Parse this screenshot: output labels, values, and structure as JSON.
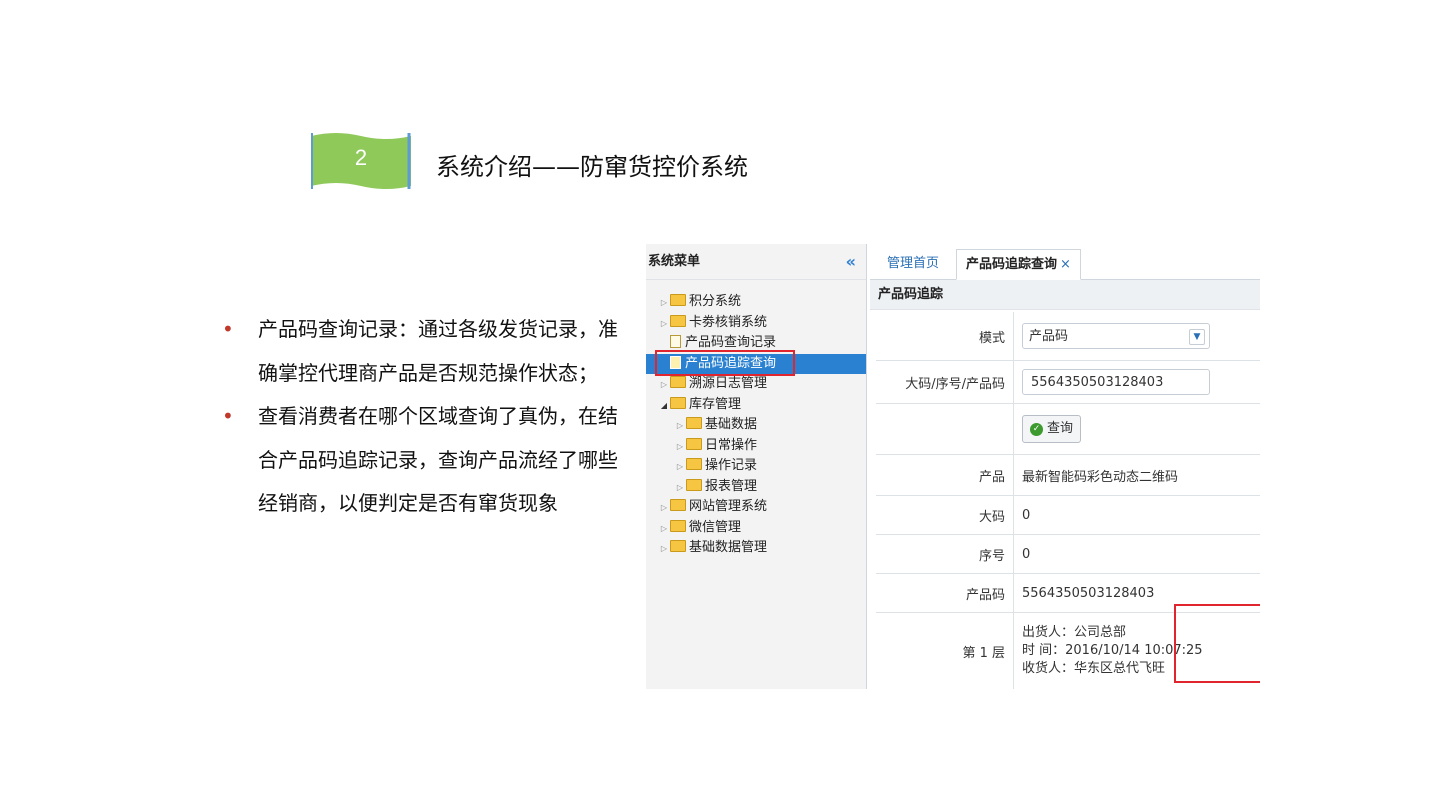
{
  "slide": {
    "section_number": "2",
    "title": "系统介绍——防窜货控价系统",
    "accent_color": "#8fc95a",
    "bullets": [
      "产品码查询记录：通过各级发货记录，准确掌控代理商产品是否规范操作状态；",
      "查看消费者在哪个区域查询了真伪，在结合产品码追踪记录，查询产品流经了哪些经销商，以便判定是否有窜货现象"
    ]
  },
  "sidebar": {
    "title": "系统菜单",
    "items": [
      {
        "label": "积分系统",
        "type": "folder",
        "level": 0
      },
      {
        "label": "卡劵核销系统",
        "type": "folder",
        "level": 0
      },
      {
        "label": "产品码查询记录",
        "type": "file",
        "level": 0
      },
      {
        "label": "产品码追踪查询",
        "type": "file",
        "level": 0,
        "selected": true
      },
      {
        "label": "溯源日志管理",
        "type": "folder",
        "level": 0
      },
      {
        "label": "库存管理",
        "type": "folder",
        "level": 0,
        "expanded": true
      },
      {
        "label": "基础数据",
        "type": "folder",
        "level": 1
      },
      {
        "label": "日常操作",
        "type": "folder",
        "level": 1
      },
      {
        "label": "操作记录",
        "type": "folder",
        "level": 1
      },
      {
        "label": "报表管理",
        "type": "folder",
        "level": 1
      },
      {
        "label": "网站管理系统",
        "type": "folder",
        "level": 0
      },
      {
        "label": "微信管理",
        "type": "folder",
        "level": 0
      },
      {
        "label": "基础数据管理",
        "type": "folder",
        "level": 0
      }
    ]
  },
  "tabs": {
    "home": "管理首页",
    "active": "产品码追踪查询",
    "close": "×"
  },
  "panel": {
    "title": "产品码追踪",
    "mode_label": "模式",
    "mode_value": "产品码",
    "code_label": "大码/序号/产品码",
    "code_value": "5564350503128403",
    "query_button": "查询",
    "product_label": "产品",
    "product_value": "最新智能码彩色动态二维码",
    "bigcode_label": "大码",
    "bigcode_value": "0",
    "serial_label": "序号",
    "serial_value": "0",
    "productcode_label": "产品码",
    "productcode_value": "5564350503128403",
    "layer_label": "第 1 层",
    "layer_lines": [
      "出货人：公司总部",
      "时 间：2016/10/14 10:07:25",
      "收货人：华东区总代飞旺"
    ]
  }
}
